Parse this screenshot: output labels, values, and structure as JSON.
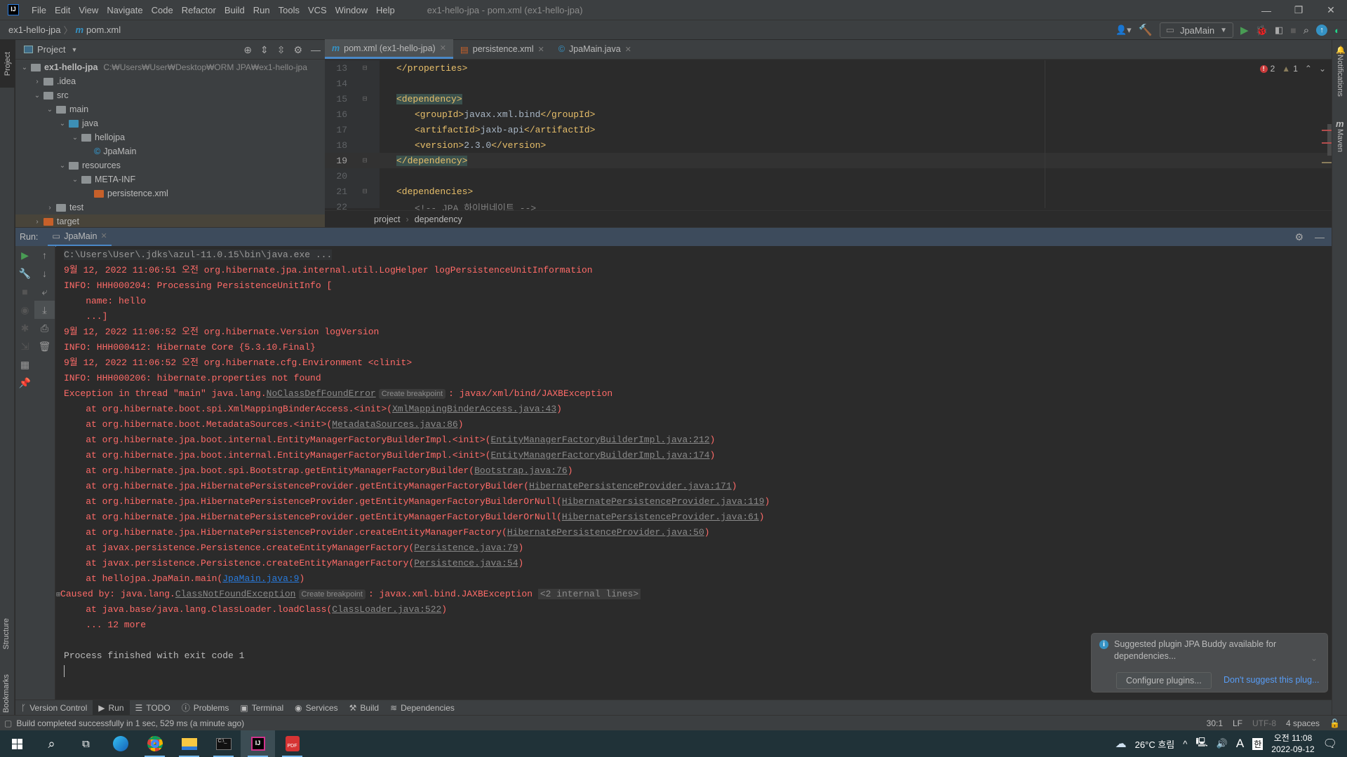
{
  "window": {
    "title": "ex1-hello-jpa - pom.xml (ex1-hello-jpa)",
    "menu": [
      "File",
      "Edit",
      "View",
      "Navigate",
      "Code",
      "Refactor",
      "Build",
      "Run",
      "Tools",
      "VCS",
      "Window",
      "Help"
    ],
    "controls": {
      "minimize": "—",
      "restore": "❐",
      "close": "✕"
    }
  },
  "navbar": {
    "project": "ex1-hello-jpa",
    "file": "pom.xml",
    "run_config": "JpaMain"
  },
  "side_tabs": {
    "left_top": "Project",
    "left_bottom": [
      "Structure",
      "Bookmarks"
    ],
    "right": [
      "Notifications",
      "Maven"
    ]
  },
  "project_panel": {
    "title": "Project",
    "tree": [
      {
        "label": "ex1-hello-jpa",
        "path": "C:₩Users₩User₩Desktop₩ORM JPA₩ex1-hello-jpa",
        "depth": 0,
        "expanded": true,
        "kind": "module"
      },
      {
        "label": ".idea",
        "depth": 1,
        "expanded": false,
        "kind": "folder"
      },
      {
        "label": "src",
        "depth": 1,
        "expanded": true,
        "kind": "folder"
      },
      {
        "label": "main",
        "depth": 2,
        "expanded": true,
        "kind": "folder"
      },
      {
        "label": "java",
        "depth": 3,
        "expanded": true,
        "kind": "source"
      },
      {
        "label": "hellojpa",
        "depth": 4,
        "expanded": true,
        "kind": "package"
      },
      {
        "label": "JpaMain",
        "depth": 5,
        "kind": "class"
      },
      {
        "label": "resources",
        "depth": 3,
        "expanded": true,
        "kind": "resources"
      },
      {
        "label": "META-INF",
        "depth": 4,
        "expanded": true,
        "kind": "folder"
      },
      {
        "label": "persistence.xml",
        "depth": 5,
        "kind": "xml"
      },
      {
        "label": "test",
        "depth": 2,
        "expanded": false,
        "kind": "folder"
      },
      {
        "label": "target",
        "depth": 1,
        "expanded": false,
        "kind": "excluded"
      }
    ]
  },
  "editor": {
    "tabs": [
      {
        "label": "pom.xml (ex1-hello-jpa)",
        "active": true
      },
      {
        "label": "persistence.xml",
        "active": false
      },
      {
        "label": "JpaMain.java",
        "active": false
      }
    ],
    "errors": "2",
    "warnings": "1",
    "lines": [
      {
        "n": "13",
        "indent": 1,
        "parts": [
          [
            "tag",
            "</properties>"
          ]
        ]
      },
      {
        "n": "14",
        "indent": 0,
        "parts": []
      },
      {
        "n": "15",
        "indent": 1,
        "parts": [
          [
            "tag hl",
            "<dependency>"
          ]
        ]
      },
      {
        "n": "16",
        "indent": 2,
        "parts": [
          [
            "tag",
            "<groupId>"
          ],
          [
            "txt",
            "javax.xml.bind"
          ],
          [
            "tag",
            "</groupId>"
          ]
        ]
      },
      {
        "n": "17",
        "indent": 2,
        "parts": [
          [
            "tag",
            "<artifactId>"
          ],
          [
            "txt",
            "jaxb-api"
          ],
          [
            "tag",
            "</artifactId>"
          ]
        ]
      },
      {
        "n": "18",
        "indent": 2,
        "parts": [
          [
            "tag",
            "<version>"
          ],
          [
            "txt",
            "2.3.0"
          ],
          [
            "tag",
            "</version>"
          ]
        ]
      },
      {
        "n": "19",
        "indent": 1,
        "parts": [
          [
            "tag hl",
            "</dependency>"
          ]
        ],
        "current": true
      },
      {
        "n": "20",
        "indent": 0,
        "parts": []
      },
      {
        "n": "21",
        "indent": 1,
        "parts": [
          [
            "tag",
            "<dependencies>"
          ]
        ]
      },
      {
        "n": "22",
        "indent": 2,
        "parts": [
          [
            "cmt",
            "<!-- JPA 하이버네이트 -->"
          ]
        ]
      }
    ],
    "breadcrumb": [
      "project",
      "dependency"
    ]
  },
  "run_panel": {
    "label": "Run:",
    "tab": "JpaMain",
    "command": "C:\\Users\\User\\.jdks\\azul-11.0.15\\bin\\java.exe ...",
    "log": [
      "9월 12, 2022 11:06:51 오전 org.hibernate.jpa.internal.util.LogHelper logPersistenceUnitInformation",
      "INFO: HHH000204: Processing PersistenceUnitInfo [",
      "    name: hello",
      "    ...]",
      "9월 12, 2022 11:06:52 오전 org.hibernate.Version logVersion",
      "INFO: HHH000412: Hibernate Core {5.3.10.Final}",
      "9월 12, 2022 11:06:52 오전 org.hibernate.cfg.Environment <clinit>",
      "INFO: HHH000206: hibernate.properties not found"
    ],
    "exception": {
      "prefix": "Exception in thread \"main\" java.lang.",
      "class": "NoClassDefFoundError",
      "breakpoint": "Create breakpoint",
      "message": ": javax/xml/bind/JAXBException"
    },
    "stack": [
      {
        "at": "org.hibernate.boot.spi.XmlMappingBinderAccess.<init>",
        "src": "XmlMappingBinderAccess.java:43"
      },
      {
        "at": "org.hibernate.boot.MetadataSources.<init>",
        "src": "MetadataSources.java:86"
      },
      {
        "at": "org.hibernate.jpa.boot.internal.EntityManagerFactoryBuilderImpl.<init>",
        "src": "EntityManagerFactoryBuilderImpl.java:212"
      },
      {
        "at": "org.hibernate.jpa.boot.internal.EntityManagerFactoryBuilderImpl.<init>",
        "src": "EntityManagerFactoryBuilderImpl.java:174"
      },
      {
        "at": "org.hibernate.jpa.boot.spi.Bootstrap.getEntityManagerFactoryBuilder",
        "src": "Bootstrap.java:76"
      },
      {
        "at": "org.hibernate.jpa.HibernatePersistenceProvider.getEntityManagerFactoryBuilder",
        "src": "HibernatePersistenceProvider.java:171"
      },
      {
        "at": "org.hibernate.jpa.HibernatePersistenceProvider.getEntityManagerFactoryBuilderOrNull",
        "src": "HibernatePersistenceProvider.java:119"
      },
      {
        "at": "org.hibernate.jpa.HibernatePersistenceProvider.getEntityManagerFactoryBuilderOrNull",
        "src": "HibernatePersistenceProvider.java:61"
      },
      {
        "at": "org.hibernate.jpa.HibernatePersistenceProvider.createEntityManagerFactory",
        "src": "HibernatePersistenceProvider.java:50"
      },
      {
        "at": "javax.persistence.Persistence.createEntityManagerFactory",
        "src": "Persistence.java:79"
      },
      {
        "at": "javax.persistence.Persistence.createEntityManagerFactory",
        "src": "Persistence.java:54"
      },
      {
        "at": "hellojpa.JpaMain.main",
        "src": "JpaMain.java:9",
        "user": true
      }
    ],
    "caused_by": {
      "prefix": "Caused by: java.lang.",
      "class": "ClassNotFoundException",
      "breakpoint": "Create breakpoint",
      "message": ": javax.xml.bind.JAXBException",
      "internal": "<2 internal lines>"
    },
    "caused_stack": [
      {
        "at": "java.base/java.lang.ClassLoader.loadClass",
        "src": "ClassLoader.java:522"
      }
    ],
    "more": "    ... 12 more",
    "exit": "Process finished with exit code 1"
  },
  "notification": {
    "message": "Suggested plugin JPA Buddy available for dependencies...",
    "configure": "Configure plugins...",
    "dismiss": "Don't suggest this plug..."
  },
  "tool_windows": [
    {
      "label": "Version Control",
      "icon": "branch-icon"
    },
    {
      "label": "Run",
      "icon": "run-icon",
      "active": true
    },
    {
      "label": "TODO",
      "icon": "list-icon"
    },
    {
      "label": "Problems",
      "icon": "problems-icon"
    },
    {
      "label": "Terminal",
      "icon": "terminal-icon"
    },
    {
      "label": "Services",
      "icon": "services-icon"
    },
    {
      "label": "Build",
      "icon": "hammer-icon"
    },
    {
      "label": "Dependencies",
      "icon": "layers-icon"
    }
  ],
  "status": {
    "message": "Build completed successfully in 1 sec, 529 ms (a minute ago)",
    "position": "30:1",
    "line_sep": "LF",
    "encoding": "UTF-8",
    "indent": "4 spaces"
  },
  "taskbar": {
    "weather": "26°C 흐림",
    "ime_a": "A",
    "ime_han": "한",
    "time": "오전 11:08",
    "date": "2022-09-12"
  }
}
